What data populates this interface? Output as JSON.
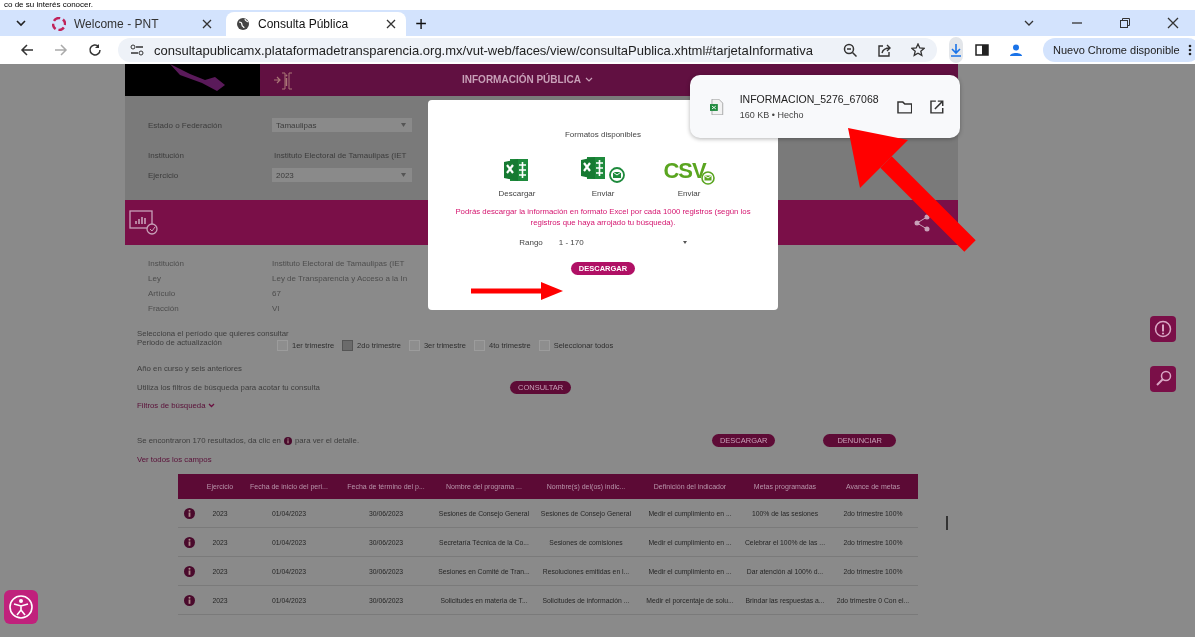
{
  "caption": "co de su interés conocer.",
  "browser": {
    "tabs": [
      {
        "title": "Welcome - PNT",
        "selected": false,
        "kind": "pnt"
      },
      {
        "title": "Consulta Pública",
        "selected": true,
        "kind": "globe"
      }
    ],
    "new_tab": "+",
    "url": "consultapublicamx.plataformadetransparencia.org.mx/vut-web/faces/view/consultaPublica.xhtml#tarjetaInformativa",
    "update_button": "Nuevo Chrome disponible"
  },
  "page": {
    "header_title": "INFORMACIÓN PÚBLICA",
    "form": [
      {
        "label": "Estado o Federación",
        "value": "Tamaulipas",
        "kind": "select"
      },
      {
        "label": "Institución",
        "value": "Instituto Electoral de Tamaulipas (IET",
        "kind": "text"
      },
      {
        "label": "Ejercicio",
        "value": "2023",
        "kind": "select"
      }
    ],
    "details": [
      {
        "label": "Institución",
        "value": "Instituto Electoral de Tamaulipas (IET"
      },
      {
        "label": "Ley",
        "value": "Ley de Transparencia y Acceso a la In"
      },
      {
        "label": "Artículo",
        "value": "67"
      },
      {
        "label": "Fracción",
        "value": "VI"
      }
    ],
    "period_prompt": "Selecciona el período que quieres consultar",
    "period_label": "Periodo de actualización",
    "periods": [
      {
        "label": "1er trimestre",
        "checked": false
      },
      {
        "label": "2do trimestre",
        "checked": true
      },
      {
        "label": "3er trimestre",
        "checked": false
      },
      {
        "label": "4to trimestre",
        "checked": false
      },
      {
        "label": "Seleccionar todos",
        "checked": false
      }
    ],
    "year_note": "Año en curso y seis anteriores",
    "filter_note": "Utiliza los filtros de búsqueda para acotar tu consulta",
    "consult_button": "CONSULTAR",
    "filters_toggle": "Filtros de búsqueda",
    "results_text": "Se encontraron 170 resultados, da clic en",
    "results_text_2": "para ver el detalle.",
    "download_button": "DESCARGAR",
    "report_button": "DENUNCIAR",
    "all_fields_link": "Ver todos los campos",
    "table": {
      "columns": [
        "Ejercicio",
        "Fecha de inicio del peri...",
        "Fecha de término del p...",
        "Nombre del programa ...",
        "Nombre(s) del(os) indic...",
        "Definición del indicador",
        "Metas programadas",
        "Avance de metas"
      ],
      "rows": [
        {
          "cells": [
            "2023",
            "01/04/2023",
            "30/06/2023",
            "Sesiones de Consejo General",
            "Sesiones de Consejo General",
            "Medir el cumplimiento en ...",
            "100% de las sesiones",
            "2do trimestre 100%"
          ]
        },
        {
          "cells": [
            "2023",
            "01/04/2023",
            "30/06/2023",
            "Secretaría Técnica de la Co...",
            "Sesiones de comisiones",
            "Medir el cumplimiento en ...",
            "Celebrar el 100% de las ...",
            "2do trimestre 100%"
          ]
        },
        {
          "cells": [
            "2023",
            "01/04/2023",
            "30/06/2023",
            "Sesiones en Comité de Tran...",
            "Resoluciones emitidas en l...",
            "Medir el cumplimiento en ...",
            "Dar atención al 100% d...",
            "2do trimestre 100%"
          ]
        },
        {
          "cells": [
            "2023",
            "01/04/2023",
            "30/06/2023",
            "Solicitudes en materia de T...",
            "Solicitudes de información ...",
            "Medir el porcentaje de solu...",
            "Brindar las respuestas a...",
            "2do trimestre 0 Con el..."
          ]
        }
      ]
    }
  },
  "modal": {
    "title": "Formatos disponibles",
    "formats": [
      {
        "kind": "excel",
        "label": "Descargar"
      },
      {
        "kind": "excel-mail",
        "label": "Enviar"
      },
      {
        "kind": "csv-mail",
        "label": "Enviar",
        "icon_text": "CSV"
      }
    ],
    "notice": "Podrás descargar la información en formato Excel por cada 1000 registros (según los registros que haya arrojado tu búsqueda).",
    "range_label": "Rango",
    "range_value": "1 - 170",
    "button": "DESCARGAR"
  },
  "download_bubble": {
    "file_name": "INFORMACION_5276_67068",
    "status": "160 KB • Hecho"
  }
}
